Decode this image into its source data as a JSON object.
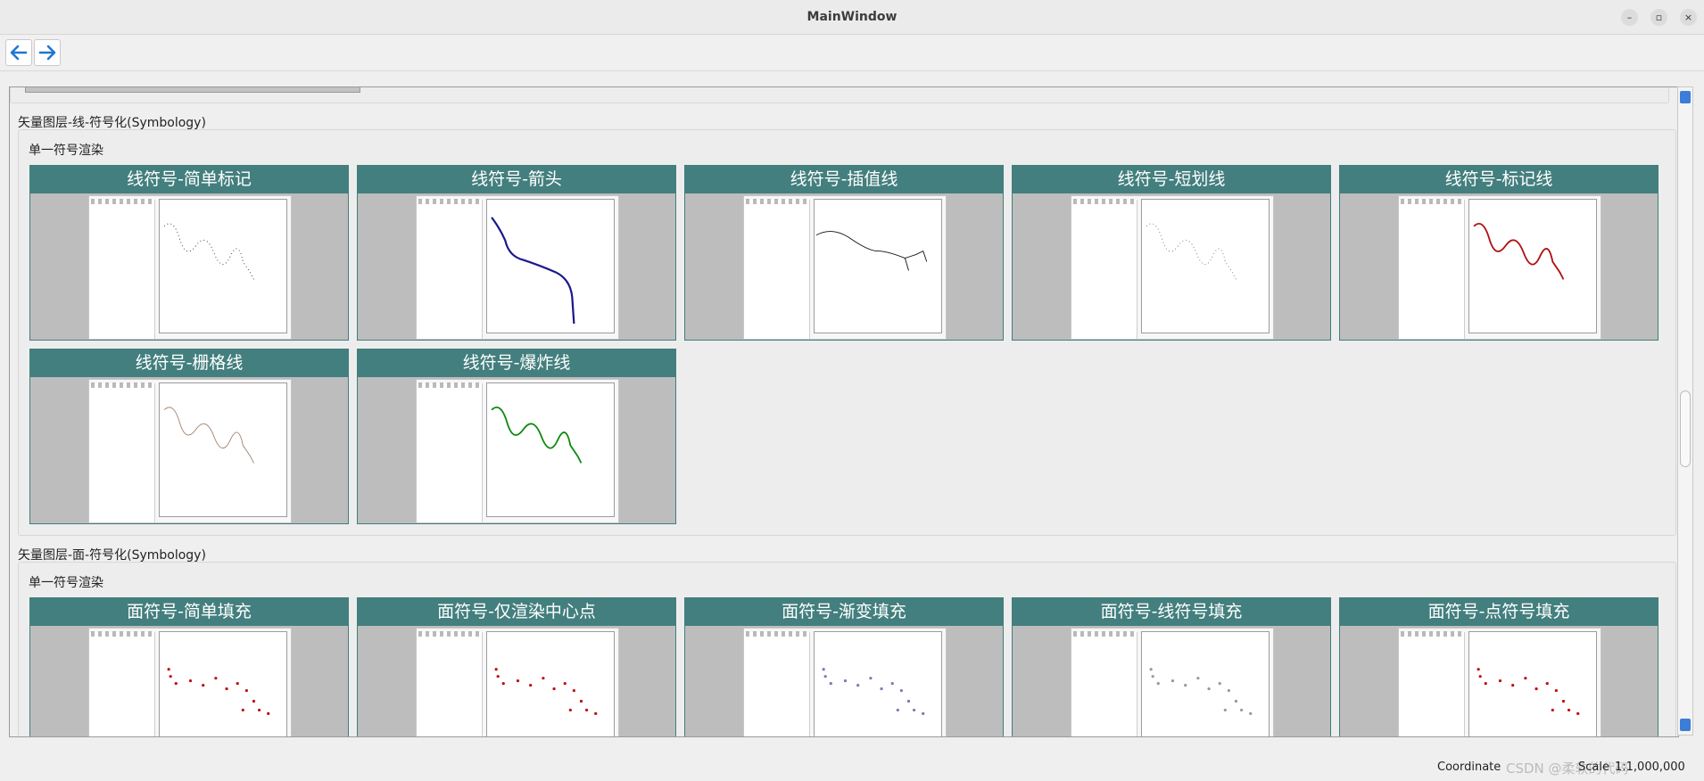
{
  "window": {
    "title": "MainWindow",
    "minimize_glyph": "–",
    "maximize_glyph": "▫",
    "close_glyph": "×"
  },
  "toolbar": {
    "back_icon": "arrow-left-icon",
    "forward_icon": "arrow-right-icon",
    "accent": "#1f77d0"
  },
  "sections": [
    {
      "title": "矢量图层-线-符号化(Symbology)",
      "subgroup": "单一符号渲染",
      "cards": [
        {
          "label": "线符号-简单标记",
          "line_color": "#333333",
          "style": "dots"
        },
        {
          "label": "线符号-箭头",
          "line_color": "#1a1a8c",
          "style": "thick"
        },
        {
          "label": "线符号-插值线",
          "line_color": "#111111",
          "style": "branch"
        },
        {
          "label": "线符号-短划线",
          "line_color": "#777777",
          "style": "dots"
        },
        {
          "label": "线符号-标记线",
          "line_color": "#b01010",
          "style": "dense"
        },
        {
          "label": "线符号-栅格线",
          "line_color": "#a0826d",
          "style": "thin"
        },
        {
          "label": "线符号-爆炸线",
          "line_color": "#0f8a0f",
          "style": "dense"
        }
      ]
    },
    {
      "title": "矢量图层-面-符号化(Symbology)",
      "subgroup": "单一符号渲染",
      "cards": [
        {
          "label": "面符号-简单填充",
          "line_color": "#c01010",
          "style": "points"
        },
        {
          "label": "面符号-仅渲染中心点",
          "line_color": "#c01010",
          "style": "points"
        },
        {
          "label": "面符号-渐变填充",
          "line_color": "#7a7ab0",
          "style": "points"
        },
        {
          "label": "面符号-线符号填充",
          "line_color": "#999999",
          "style": "points"
        },
        {
          "label": "面符号-点符号填充",
          "line_color": "#c01010",
          "style": "points"
        }
      ]
    }
  ],
  "statusbar": {
    "coordinate_label": "Coordinate",
    "watermark": "CSDN @柔软的代码",
    "scale_label": "Scale",
    "scale_value": "1:1,000,000"
  }
}
